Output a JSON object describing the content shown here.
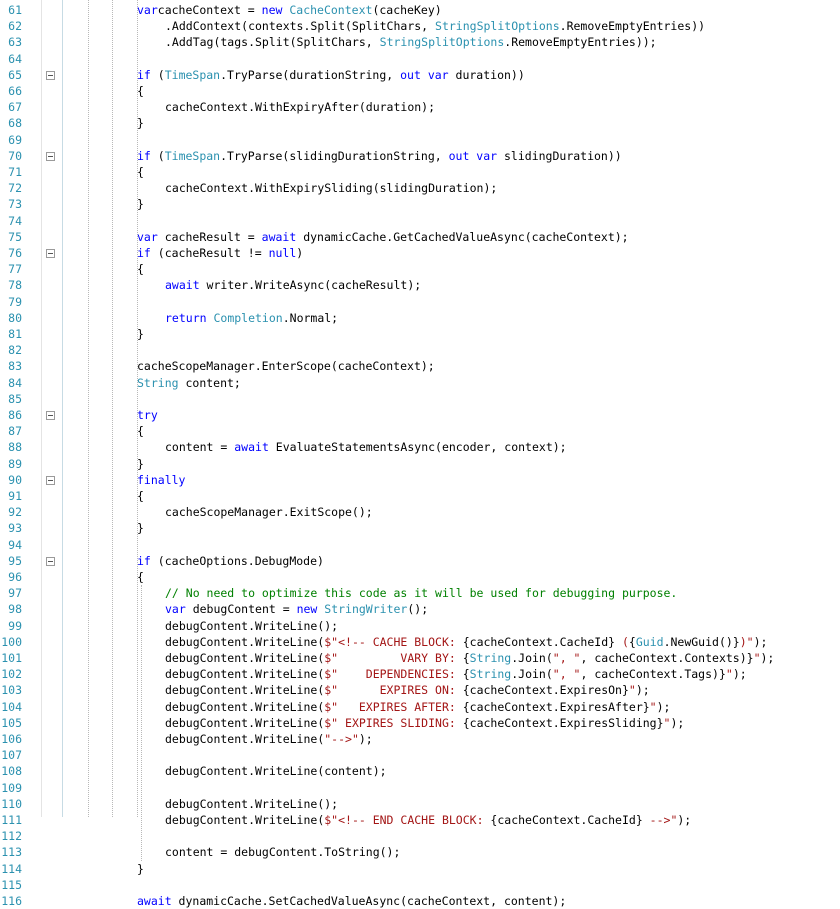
{
  "editor": {
    "lines": [
      {
        "n": "61",
        "indent": 0,
        "tokens": [
          [
            "kw",
            "var"
          ],
          [
            "",
            "cacheContext = "
          ],
          [
            "kw",
            "new"
          ],
          [
            "",
            ""
          ],
          [
            "ty",
            " CacheContext"
          ],
          [
            "",
            "(cacheKey)"
          ]
        ]
      },
      {
        "n": "62",
        "indent": 1,
        "tokens": [
          [
            "",
            ".AddContext(contexts.Split(SplitChars, "
          ],
          [
            "ty",
            "StringSplitOptions"
          ],
          [
            "",
            ".RemoveEmptyEntries))"
          ]
        ]
      },
      {
        "n": "63",
        "indent": 1,
        "tokens": [
          [
            "",
            ".AddTag(tags.Split(SplitChars, "
          ],
          [
            "ty",
            "StringSplitOptions"
          ],
          [
            "",
            ".RemoveEmptyEntries));"
          ]
        ]
      },
      {
        "n": "64",
        "indent": 0,
        "tokens": []
      },
      {
        "n": "65",
        "indent": 0,
        "fold": true,
        "tokens": [
          [
            "kw",
            "if"
          ],
          [
            "",
            " ("
          ],
          [
            "ty",
            "TimeSpan"
          ],
          [
            "",
            ".TryParse(durationString, "
          ],
          [
            "kw",
            "out"
          ],
          [
            "",
            ""
          ],
          [
            "kw",
            " var"
          ],
          [
            "",
            " duration))"
          ]
        ]
      },
      {
        "n": "66",
        "indent": 0,
        "tokens": [
          [
            "",
            "{"
          ]
        ]
      },
      {
        "n": "67",
        "indent": 1,
        "tokens": [
          [
            "",
            "cacheContext.WithExpiryAfter(duration);"
          ]
        ]
      },
      {
        "n": "68",
        "indent": 0,
        "tokens": [
          [
            "",
            "}"
          ]
        ]
      },
      {
        "n": "69",
        "indent": 0,
        "tokens": []
      },
      {
        "n": "70",
        "indent": 0,
        "fold": true,
        "tokens": [
          [
            "kw",
            "if"
          ],
          [
            "",
            " ("
          ],
          [
            "ty",
            "TimeSpan"
          ],
          [
            "",
            ".TryParse(slidingDurationString, "
          ],
          [
            "kw",
            "out"
          ],
          [
            "",
            ""
          ],
          [
            "kw",
            " var"
          ],
          [
            "",
            " slidingDuration))"
          ]
        ]
      },
      {
        "n": "71",
        "indent": 0,
        "tokens": [
          [
            "",
            "{"
          ]
        ]
      },
      {
        "n": "72",
        "indent": 1,
        "tokens": [
          [
            "",
            "cacheContext.WithExpirySliding(slidingDuration);"
          ]
        ]
      },
      {
        "n": "73",
        "indent": 0,
        "tokens": [
          [
            "",
            "}"
          ]
        ]
      },
      {
        "n": "74",
        "indent": 0,
        "tokens": []
      },
      {
        "n": "75",
        "indent": 0,
        "tokens": [
          [
            "kw",
            "var"
          ],
          [
            "",
            " cacheResult = "
          ],
          [
            "kw",
            "await"
          ],
          [
            "",
            " dynamicCache.GetCachedValueAsync(cacheContext);"
          ]
        ]
      },
      {
        "n": "76",
        "indent": 0,
        "fold": true,
        "tokens": [
          [
            "kw",
            "if"
          ],
          [
            "",
            " (cacheResult != "
          ],
          [
            "kw",
            "null"
          ],
          [
            "",
            ")"
          ]
        ]
      },
      {
        "n": "77",
        "indent": 0,
        "tokens": [
          [
            "",
            "{"
          ]
        ]
      },
      {
        "n": "78",
        "indent": 1,
        "tokens": [
          [
            "kw",
            "await"
          ],
          [
            "",
            " writer.WriteAsync(cacheResult);"
          ]
        ]
      },
      {
        "n": "79",
        "indent": 0,
        "tokens": []
      },
      {
        "n": "80",
        "indent": 1,
        "tokens": [
          [
            "kw",
            "return"
          ],
          [
            "",
            ""
          ],
          [
            "ty",
            " Completion"
          ],
          [
            "",
            ".Normal;"
          ]
        ]
      },
      {
        "n": "81",
        "indent": 0,
        "tokens": [
          [
            "",
            "}"
          ]
        ]
      },
      {
        "n": "82",
        "indent": 0,
        "tokens": []
      },
      {
        "n": "83",
        "indent": 0,
        "tokens": [
          [
            "",
            "cacheScopeManager.EnterScope(cacheContext);"
          ]
        ]
      },
      {
        "n": "84",
        "indent": 0,
        "tokens": [
          [
            "ty",
            "String"
          ],
          [
            "",
            " content;"
          ]
        ]
      },
      {
        "n": "85",
        "indent": 0,
        "tokens": []
      },
      {
        "n": "86",
        "indent": 0,
        "fold": true,
        "tokens": [
          [
            "kw",
            "try"
          ]
        ]
      },
      {
        "n": "87",
        "indent": 0,
        "tokens": [
          [
            "",
            "{"
          ]
        ]
      },
      {
        "n": "88",
        "indent": 1,
        "tokens": [
          [
            "",
            "content = "
          ],
          [
            "kw",
            "await"
          ],
          [
            "",
            " EvaluateStatementsAsync(encoder, context);"
          ]
        ]
      },
      {
        "n": "89",
        "indent": 0,
        "tokens": [
          [
            "",
            "}"
          ]
        ]
      },
      {
        "n": "90",
        "indent": 0,
        "fold": true,
        "tokens": [
          [
            "kw",
            "finally"
          ]
        ]
      },
      {
        "n": "91",
        "indent": 0,
        "tokens": [
          [
            "",
            "{"
          ]
        ]
      },
      {
        "n": "92",
        "indent": 1,
        "tokens": [
          [
            "",
            "cacheScopeManager.ExitScope();"
          ]
        ]
      },
      {
        "n": "93",
        "indent": 0,
        "tokens": [
          [
            "",
            "}"
          ]
        ]
      },
      {
        "n": "94",
        "indent": 0,
        "tokens": []
      },
      {
        "n": "95",
        "indent": 0,
        "fold": true,
        "tokens": [
          [
            "kw",
            "if"
          ],
          [
            "",
            " (cacheOptions.DebugMode)"
          ]
        ]
      },
      {
        "n": "96",
        "indent": 0,
        "tokens": [
          [
            "",
            "{"
          ]
        ]
      },
      {
        "n": "97",
        "indent": 1,
        "tokens": [
          [
            "cm",
            "// No need to optimize this code as it will be used for debugging purpose."
          ]
        ]
      },
      {
        "n": "98",
        "indent": 1,
        "tokens": [
          [
            "kw",
            "var"
          ],
          [
            "",
            " debugContent = "
          ],
          [
            "kw",
            "new"
          ],
          [
            "",
            ""
          ],
          [
            "ty",
            " StringWriter"
          ],
          [
            "",
            "();"
          ]
        ]
      },
      {
        "n": "99",
        "indent": 1,
        "tokens": [
          [
            "",
            "debugContent.WriteLine();"
          ]
        ]
      },
      {
        "n": "100",
        "indent": 1,
        "tokens": [
          [
            "",
            "debugContent.WriteLine("
          ],
          [
            "str",
            "$\"<!-- CACHE BLOCK: "
          ],
          [
            "",
            "{cacheContext.CacheId}"
          ],
          [
            "str",
            " ("
          ],
          [
            "",
            "{"
          ],
          [
            "ty",
            "Guid"
          ],
          [
            "",
            ".NewGuid()}"
          ],
          [
            "str",
            ")\""
          ],
          [
            "",
            ");"
          ]
        ]
      },
      {
        "n": "101",
        "indent": 1,
        "tokens": [
          [
            "",
            "debugContent.WriteLine("
          ],
          [
            "str",
            "$\"         VARY BY: "
          ],
          [
            "",
            "{"
          ],
          [
            "ty",
            "String"
          ],
          [
            "",
            ".Join("
          ],
          [
            "str",
            "\", \""
          ],
          [
            "",
            ", cacheContext.Contexts)}"
          ],
          [
            "str",
            "\""
          ],
          [
            "",
            ");"
          ]
        ]
      },
      {
        "n": "102",
        "indent": 1,
        "tokens": [
          [
            "",
            "debugContent.WriteLine("
          ],
          [
            "str",
            "$\"    DEPENDENCIES: "
          ],
          [
            "",
            "{"
          ],
          [
            "ty",
            "String"
          ],
          [
            "",
            ".Join("
          ],
          [
            "str",
            "\", \""
          ],
          [
            "",
            ", cacheContext.Tags)}"
          ],
          [
            "str",
            "\""
          ],
          [
            "",
            ");"
          ]
        ]
      },
      {
        "n": "103",
        "indent": 1,
        "tokens": [
          [
            "",
            "debugContent.WriteLine("
          ],
          [
            "str",
            "$\"      EXPIRES ON: "
          ],
          [
            "",
            "{cacheContext.ExpiresOn}"
          ],
          [
            "str",
            "\""
          ],
          [
            "",
            ");"
          ]
        ]
      },
      {
        "n": "104",
        "indent": 1,
        "tokens": [
          [
            "",
            "debugContent.WriteLine("
          ],
          [
            "str",
            "$\"   EXPIRES AFTER: "
          ],
          [
            "",
            "{cacheContext.ExpiresAfter}"
          ],
          [
            "str",
            "\""
          ],
          [
            "",
            ");"
          ]
        ]
      },
      {
        "n": "105",
        "indent": 1,
        "tokens": [
          [
            "",
            "debugContent.WriteLine("
          ],
          [
            "str",
            "$\" EXPIRES SLIDING: "
          ],
          [
            "",
            "{cacheContext.ExpiresSliding}"
          ],
          [
            "str",
            "\""
          ],
          [
            "",
            ");"
          ]
        ]
      },
      {
        "n": "106",
        "indent": 1,
        "tokens": [
          [
            "",
            "debugContent.WriteLine("
          ],
          [
            "str",
            "\"-->\""
          ],
          [
            "",
            ");"
          ]
        ]
      },
      {
        "n": "107",
        "indent": 0,
        "tokens": []
      },
      {
        "n": "108",
        "indent": 1,
        "tokens": [
          [
            "",
            "debugContent.WriteLine(content);"
          ]
        ]
      },
      {
        "n": "109",
        "indent": 0,
        "tokens": []
      },
      {
        "n": "110",
        "indent": 1,
        "tokens": [
          [
            "",
            "debugContent.WriteLine();"
          ]
        ]
      },
      {
        "n": "111",
        "indent": 1,
        "tokens": [
          [
            "",
            "debugContent.WriteLine("
          ],
          [
            "str",
            "$\"<!-- END CACHE BLOCK: "
          ],
          [
            "",
            "{cacheContext.CacheId}"
          ],
          [
            "str",
            " -->\""
          ],
          [
            "",
            ");"
          ]
        ]
      },
      {
        "n": "112",
        "indent": 0,
        "tokens": []
      },
      {
        "n": "113",
        "indent": 1,
        "tokens": [
          [
            "",
            "content = debugContent.ToString();"
          ]
        ]
      },
      {
        "n": "114",
        "indent": 0,
        "tokens": [
          [
            "",
            "}"
          ]
        ]
      },
      {
        "n": "115",
        "indent": 0,
        "tokens": []
      },
      {
        "n": "116",
        "indent": 0,
        "tokens": [
          [
            "kw",
            "await"
          ],
          [
            "",
            " dynamicCache.SetCachedValueAsync(cacheContext, content);"
          ]
        ]
      }
    ]
  },
  "colors": {
    "keyword": "#0000ff",
    "type": "#2b91af",
    "string": "#a31515",
    "comment": "#008000",
    "line_number": "#2b91af"
  }
}
